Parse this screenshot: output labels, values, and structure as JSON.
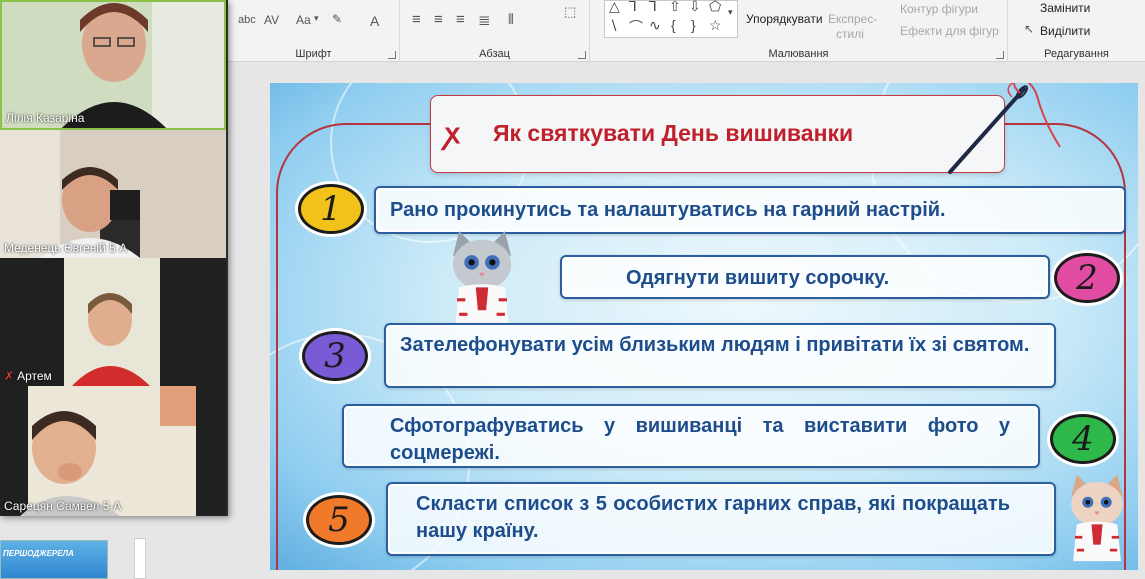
{
  "ribbon": {
    "font_controls": [
      "abc",
      "AV",
      "Aa",
      "A"
    ],
    "groups": {
      "font": "Шрифт",
      "paragraph": "Абзац",
      "drawing": "Малювання",
      "editing": "Редагування"
    },
    "arrange_label": "Упорядкувати",
    "quick_styles_line1": "Експрес-",
    "quick_styles_line2": "стилі",
    "shape_outline": "Контур фігури",
    "shape_effects": "Ефекти для фігур",
    "replace": "Замінити",
    "select": "Виділити"
  },
  "slide": {
    "title": "Як святкувати День вишиванки",
    "items": [
      {
        "number": "1",
        "text": "Рано прокинутись та налаштуватись на гарний настрій."
      },
      {
        "number": "2",
        "text": "Одягнути вишиту сорочку."
      },
      {
        "number": "3",
        "text": "Зателефонувати усім близьким людям і привітати їх зі святом."
      },
      {
        "number": "4",
        "text": "Сфотографуватись у вишиванці та виставити фото у соцмережі."
      },
      {
        "number": "5",
        "text": "Скласти список з 5 особистих гарних справ, які покращать нашу країну."
      }
    ],
    "number_colors": [
      "#f2c21b",
      "#e24ca3",
      "#7a5bd6",
      "#2fb84a",
      "#f07a2a"
    ]
  },
  "participants": [
    {
      "name": "Лілія Казаріна",
      "muted": false
    },
    {
      "name": "Меденець Євгеній 5 А",
      "muted": false
    },
    {
      "name": "Артем",
      "muted": true
    },
    {
      "name": "Сарецян Самвел 5-А",
      "muted": false
    }
  ],
  "thumbnail_label": "ПЕРШОДЖЕРЕЛА"
}
